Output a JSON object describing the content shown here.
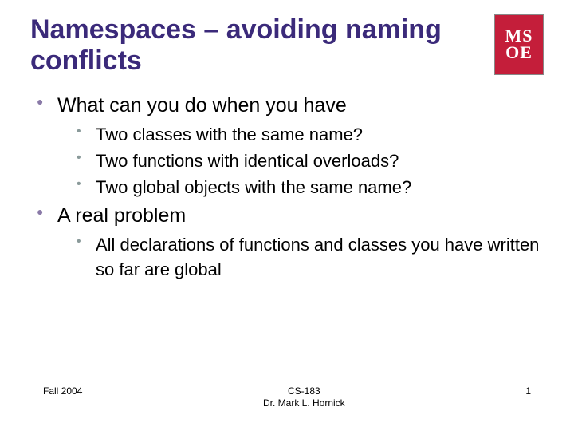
{
  "title": "Namespaces – avoiding naming conflicts",
  "logo": {
    "line1": "MS",
    "line2": "OE"
  },
  "bullets": [
    {
      "text": "What can you do when you have",
      "children": [
        "Two classes with the same name?",
        "Two functions with identical overloads?",
        "Two global objects with the same name?"
      ]
    },
    {
      "text": "A real problem",
      "children": [
        "All declarations of functions and classes you have written so far are global"
      ]
    }
  ],
  "footer": {
    "left": "Fall 2004",
    "center_line1": "CS-183",
    "center_line2": "Dr. Mark L. Hornick",
    "right": "1"
  }
}
